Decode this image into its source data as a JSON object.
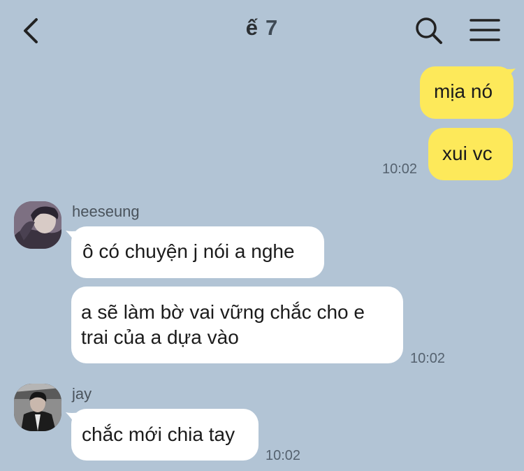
{
  "header": {
    "title": "ế",
    "member_count": "7"
  },
  "messages": {
    "me_1": "mịa nó",
    "me_2": "xui vc",
    "me_time": "10:02",
    "heeseung": {
      "name": "heeseung",
      "msg_1": "ô có chuyện j nói a nghe",
      "msg_2_line1": "a sẽ làm bờ vai vững chắc cho e",
      "msg_2_line2": "trai của a dựa vào",
      "time": "10:02"
    },
    "jay": {
      "name": "jay",
      "msg_1": "chắc mới chia tay",
      "time": "10:02"
    }
  },
  "colors": {
    "background": "#b2c4d5",
    "my_bubble": "#fde95a",
    "their_bubble": "#ffffff"
  },
  "icons": [
    "back-arrow-icon",
    "search-icon",
    "menu-icon"
  ]
}
